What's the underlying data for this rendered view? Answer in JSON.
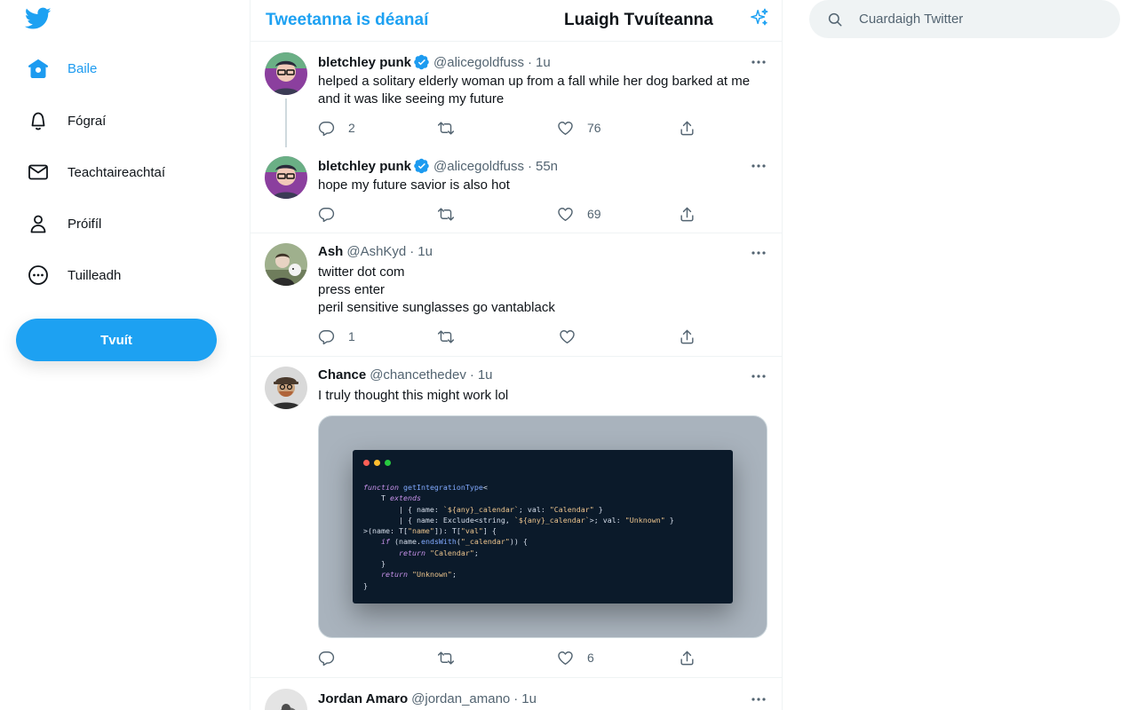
{
  "colors": {
    "accent": "#1da1f2",
    "text": "#0f1419",
    "muted": "#536471",
    "border": "#eff3f4"
  },
  "nav": {
    "logo_icon": "twitter-bird-icon",
    "items": [
      {
        "label": "Baile",
        "icon": "home-icon",
        "active": true
      },
      {
        "label": "Fógraí",
        "icon": "bell-icon"
      },
      {
        "label": "Teachtaireachtaí",
        "icon": "envelope-icon"
      },
      {
        "label": "Próifíl",
        "icon": "person-icon"
      },
      {
        "label": "Tuilleadh",
        "icon": "more-circle-icon"
      }
    ],
    "tweet_button": "Tvuít"
  },
  "header": {
    "title": "Tweetanna is déanaí",
    "subtitle": "Luaigh Tvuíteanna",
    "sparkle_icon": "sparkle-icon"
  },
  "tweets": [
    {
      "name": "bletchley punk",
      "handle": "@alicegoldfuss",
      "verified": true,
      "time": "1u",
      "lines": [
        "helped a solitary elderly woman up from a fall while her dog barked at me",
        "and it was like seeing my future"
      ],
      "replies": "2",
      "retweets": "",
      "likes": "76"
    },
    {
      "name": "bletchley punk",
      "handle": "@alicegoldfuss",
      "verified": true,
      "time": "55n",
      "lines": [
        "hope my future savior is also hot"
      ],
      "replies": "",
      "retweets": "",
      "likes": "69"
    },
    {
      "name": "Ash",
      "handle": "@AshKyd",
      "verified": false,
      "time": "1u",
      "lines": [
        "twitter dot com",
        "press enter",
        "peril sensitive sunglasses go vantablack"
      ],
      "replies": "1",
      "retweets": "",
      "likes": ""
    },
    {
      "name": "Chance",
      "handle": "@chancethedev",
      "verified": false,
      "time": "1u",
      "lines": [
        "I truly thought this might work lol"
      ],
      "replies": "",
      "retweets": "",
      "likes": "6",
      "code": [
        "function getIntegrationType<",
        "    T extends",
        "        | { name: `${any}_calendar`; val: \"Calendar\" }",
        "        | { name: Exclude<string, `${any}_calendar`>; val: \"Unknown\" }",
        ">(name: T[\"name\"]): T[\"val\"] {",
        "    if (name.endsWith(\"_calendar\")) {",
        "        return \"Calendar\";",
        "    }",
        "    return \"Unknown\";",
        "}"
      ]
    },
    {
      "name": "Jordan Amaro",
      "handle": "@jordan_amano",
      "verified": false,
      "time": "1u",
      "lines": [],
      "replies": "",
      "retweets": "",
      "likes": ""
    }
  ],
  "search": {
    "placeholder": "Cuardaigh Twitter",
    "icon": "search-icon"
  }
}
